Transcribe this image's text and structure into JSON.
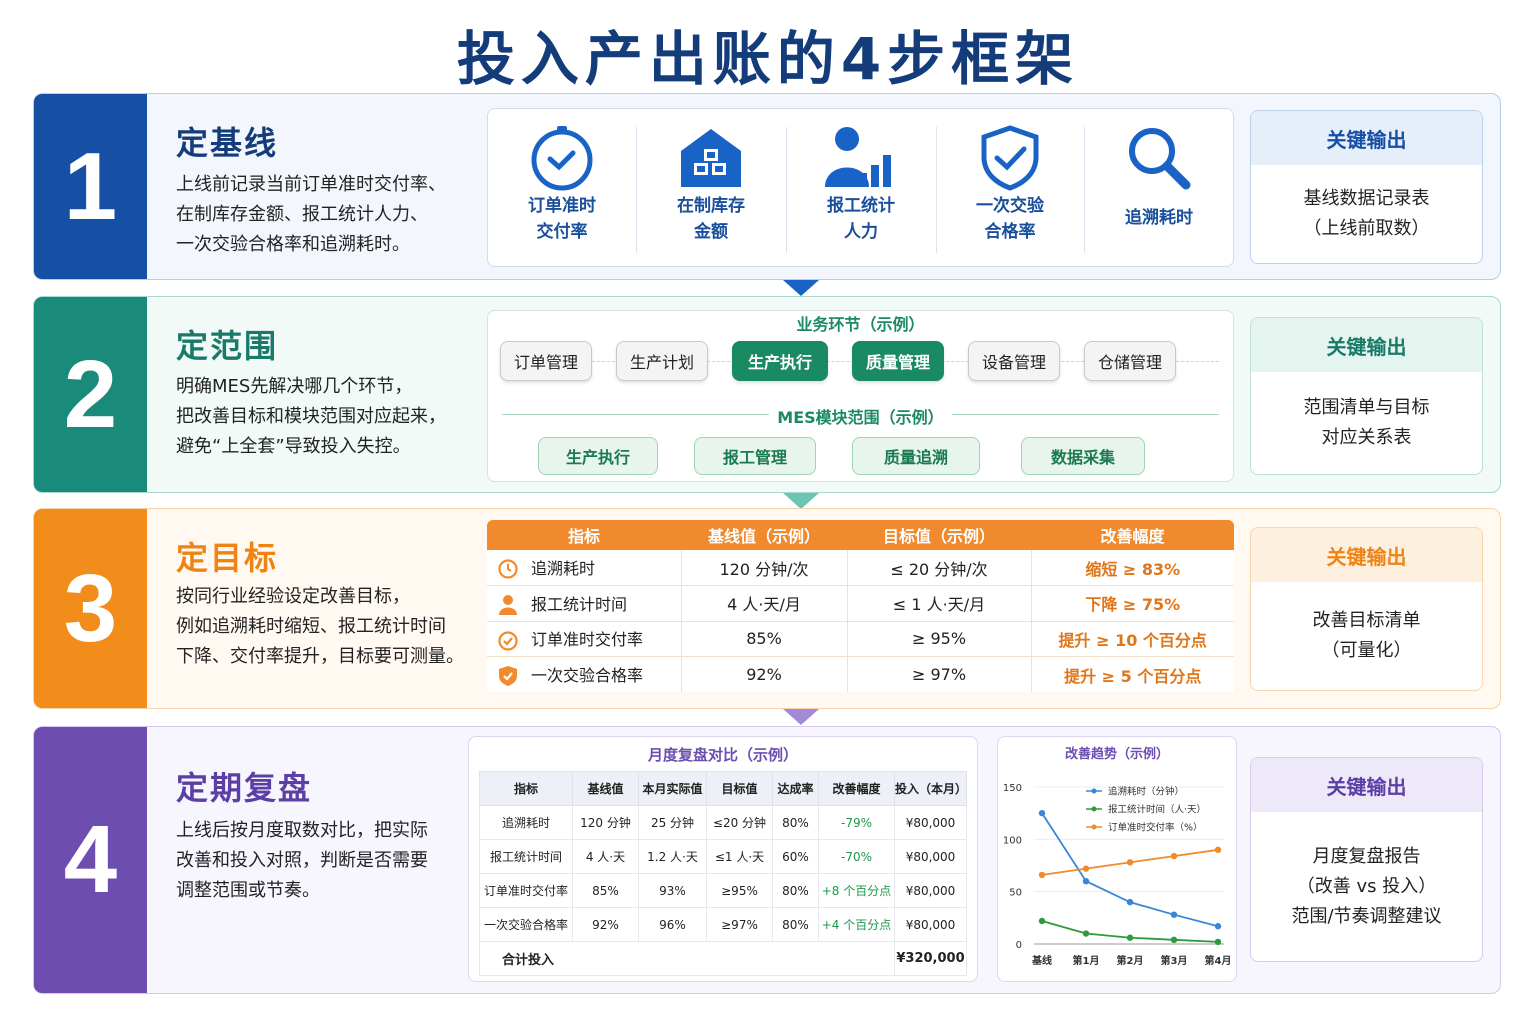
{
  "title": "投入产出账的4步框架",
  "colors": {
    "step1": "#1650a5",
    "step2": "#1a8a7a",
    "step3": "#f28c1a",
    "step4": "#6d4eb0"
  },
  "step1": {
    "number": "1",
    "title": "定基线",
    "desc_lines": [
      "上线前记录当前订单准时交付率、",
      "在制库存金额、报工统计人力、",
      "一次交验合格率和追溯耗时。"
    ],
    "metrics": [
      {
        "icon": "clock-icon",
        "lines": [
          "订单准时",
          "交付率"
        ]
      },
      {
        "icon": "warehouse-icon",
        "lines": [
          "在制库存",
          "金额"
        ]
      },
      {
        "icon": "person-chart-icon",
        "lines": [
          "报工统计",
          "人力"
        ]
      },
      {
        "icon": "shield-check-icon",
        "lines": [
          "一次交验",
          "合格率"
        ]
      },
      {
        "icon": "magnifier-icon",
        "lines": [
          "追溯耗时"
        ]
      }
    ],
    "key_title": "关键输出",
    "key_lines": [
      "基线数据记录表",
      "（上线前取数）"
    ]
  },
  "step2": {
    "number": "2",
    "title": "定范围",
    "desc_lines": [
      "明确MES先解决哪几个环节，",
      "把改善目标和模块范围对应起来，",
      "避免“上全套”导致投入失控。"
    ],
    "flow_label": "业务环节（示例）",
    "flow": [
      {
        "label": "订单管理",
        "active": false
      },
      {
        "label": "生产计划",
        "active": false
      },
      {
        "label": "生产执行",
        "active": true
      },
      {
        "label": "质量管理",
        "active": true
      },
      {
        "label": "设备管理",
        "active": false
      },
      {
        "label": "仓储管理",
        "active": false
      }
    ],
    "module_label": "MES模块范围（示例）",
    "modules": [
      "生产执行",
      "报工管理",
      "质量追溯",
      "数据采集"
    ],
    "key_title": "关键输出",
    "key_lines": [
      "范围清单与目标",
      "对应关系表"
    ]
  },
  "step3": {
    "number": "3",
    "title": "定目标",
    "desc_lines": [
      "按同行业经验设定改善目标，",
      "例如追溯耗时缩短、报工统计时间",
      "下降、交付率提升，目标要可测量。"
    ],
    "table": {
      "headers": [
        "指标",
        "基线值（示例）",
        "目标值（示例）",
        "改善幅度"
      ],
      "rows": [
        {
          "icon": "clock-icon",
          "metric": "追溯耗时",
          "baseline": "120 分钟/次",
          "target": "≤ 20 分钟/次",
          "improve": "缩短 ≥ 83%"
        },
        {
          "icon": "person-icon",
          "metric": "报工统计时间",
          "baseline": "4 人·天/月",
          "target": "≤ 1 人·天/月",
          "improve": "下降 ≥ 75%"
        },
        {
          "icon": "check-circle-icon",
          "metric": "订单准时交付率",
          "baseline": "85%",
          "target": "≥ 95%",
          "improve": "提升 ≥ 10 个百分点"
        },
        {
          "icon": "shield-check-icon",
          "metric": "一次交验合格率",
          "baseline": "92%",
          "target": "≥ 97%",
          "improve": "提升 ≥ 5 个百分点"
        }
      ]
    },
    "key_title": "关键输出",
    "key_lines": [
      "改善目标清单",
      "（可量化）"
    ]
  },
  "step4": {
    "number": "4",
    "title": "定期复盘",
    "desc_lines": [
      "上线后按月度取数对比，把实际",
      "改善和投入对照，判断是否需要",
      "调整范围或节奏。"
    ],
    "table_title": "月度复盘对比（示例）",
    "table": {
      "headers": [
        "指标",
        "基线值",
        "本月实际值",
        "目标值",
        "达成率",
        "改善幅度",
        "投入（本月）"
      ],
      "rows": [
        [
          "追溯耗时",
          "120 分钟",
          "25 分钟",
          "≤20 分钟",
          "80%",
          "-79%",
          "¥80,000"
        ],
        [
          "报工统计时间",
          "4 人·天",
          "1.2 人·天",
          "≤1 人·天",
          "60%",
          "-70%",
          "¥80,000"
        ],
        [
          "订单准时交付率",
          "85%",
          "93%",
          "≥95%",
          "80%",
          "+8 个百分点",
          "¥80,000"
        ],
        [
          "一次交验合格率",
          "92%",
          "96%",
          "≥97%",
          "80%",
          "+4 个百分点",
          "¥80,000"
        ]
      ],
      "total_label": "合计投入",
      "total_value": "¥320,000"
    },
    "key_title": "关键输出",
    "key_lines": [
      "月度复盘报告",
      "（改善 vs 投入）",
      "范围/节奏调整建议"
    ]
  },
  "chart_data": {
    "type": "line",
    "title": "改善趋势（示例）",
    "categories": [
      "基线",
      "第1月",
      "第2月",
      "第3月",
      "第4月"
    ],
    "ylim": [
      0,
      150
    ],
    "yticks": [
      0,
      50,
      100,
      150
    ],
    "legend_position": "top",
    "series": [
      {
        "name": "追溯耗时（分钟）",
        "color": "#3a86d6",
        "values": [
          125,
          60,
          40,
          28,
          17
        ]
      },
      {
        "name": "报工统计时间（人·天）",
        "color": "#2e9a3e",
        "values": [
          22,
          10,
          6,
          4,
          2
        ]
      },
      {
        "name": "订单准时交付率（%）",
        "color": "#f08a2c",
        "values": [
          66,
          72,
          78,
          84,
          90
        ]
      }
    ]
  }
}
